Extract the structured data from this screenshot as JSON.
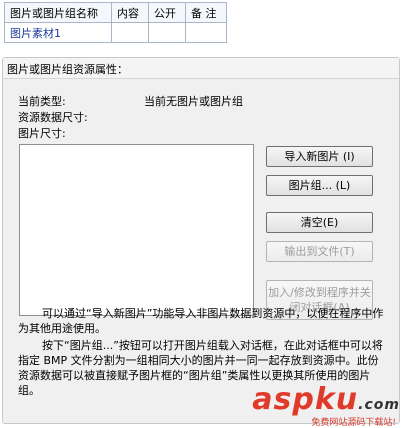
{
  "table": {
    "headers": [
      "图片或图片组名称",
      "内容",
      "公开",
      "备 注"
    ],
    "rows": [
      [
        "图片素材1",
        "",
        "",
        ""
      ]
    ]
  },
  "panel": {
    "title": "图片或图片组资源属性：",
    "current_type_label": "当前类型:",
    "current_type_value": "当前无图片或图片组",
    "data_size_label": "资源数据尺寸:",
    "image_size_label": "图片尺寸:",
    "buttons": {
      "import": "导入新图片 (I)",
      "group": "图片组... (L)",
      "clear": "清空(E)",
      "export": "输出到文件(T)",
      "add_close": "加入/修改到程序并关闭对话框(A)"
    },
    "help": [
      "可以通过“导入新图片”功能导入非图片数据到资源中，以便在程序中作为其他用途使用。",
      "按下“图片组...”按钮可以打开图片组载入对话框，在此对话框中可以将指定 BMP 文件分割为一组相同大小的图片并一同一起存放到资源中。此份资源数据可以被直接赋予图片框的“图片组”类属性以更换其所使用的图片组。"
    ]
  },
  "watermark": {
    "logo_main": "asp",
    "logo_accent": "ku",
    "logo_tld": ".com",
    "tagline": "免费网站源码下载站!"
  }
}
